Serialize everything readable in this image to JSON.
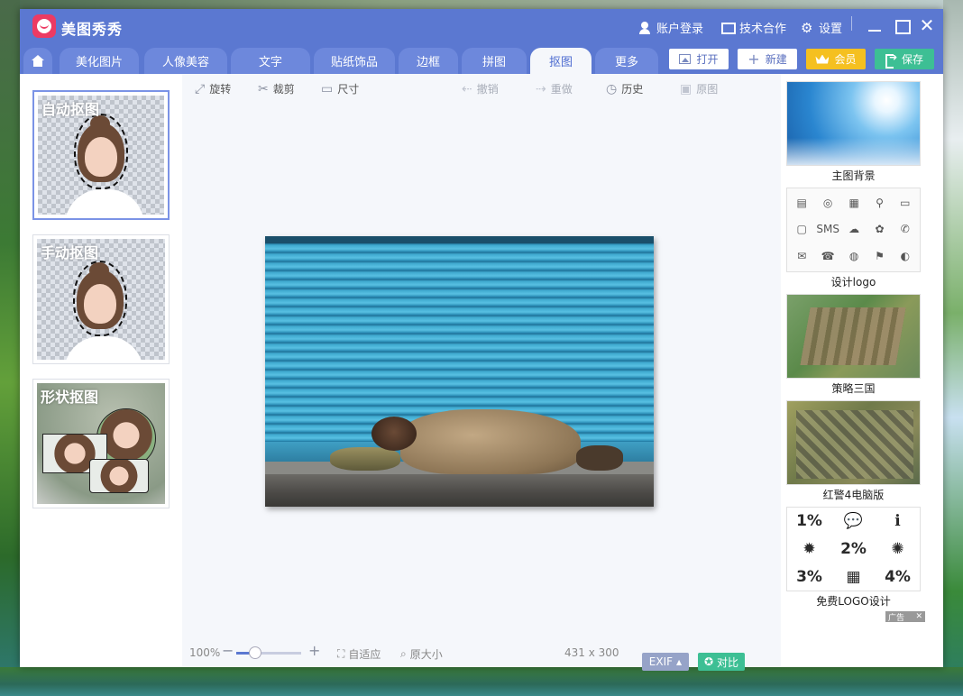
{
  "app": {
    "title": "美图秀秀",
    "account_login": "账户登录",
    "tech_coop": "技术合作",
    "settings": "设置"
  },
  "tabs": [
    {
      "label": "美化图片"
    },
    {
      "label": "人像美容"
    },
    {
      "label": "文字"
    },
    {
      "label": "贴纸饰品"
    },
    {
      "label": "边框"
    },
    {
      "label": "拼图"
    },
    {
      "label": "抠图",
      "active": true
    },
    {
      "label": "更多"
    }
  ],
  "actions": {
    "open": "打开",
    "new": "新建",
    "vip": "会员",
    "save": "保存"
  },
  "cutout_modes": [
    {
      "label": "自动抠图",
      "selected": true
    },
    {
      "label": "手动抠图"
    },
    {
      "label": "形状抠图"
    }
  ],
  "toolbar": {
    "rotate": "旋转",
    "crop": "裁剪",
    "size": "尺寸",
    "undo": "撤销",
    "redo": "重做",
    "history": "历史",
    "original": "原图"
  },
  "statusbar": {
    "zoom": "100%",
    "fit": "自适应",
    "original_size": "原大小",
    "dimensions": "431 x 300",
    "exif": "EXIF",
    "compare": "对比"
  },
  "ads": [
    {
      "caption": "主图背景"
    },
    {
      "caption": "设计logo"
    },
    {
      "caption": "策略三国"
    },
    {
      "caption": "红警4电脑版"
    },
    {
      "caption": "免费LOGO设计"
    }
  ],
  "ad_badge": "广告",
  "logo_grid_items": [
    "1%",
    "💬",
    "ℹ",
    "✹",
    "2%",
    "✺",
    "3%",
    "▦",
    "4%"
  ],
  "colors": {
    "accent": "#5b78d1",
    "vip": "#f5c020",
    "save": "#3dbf94"
  }
}
